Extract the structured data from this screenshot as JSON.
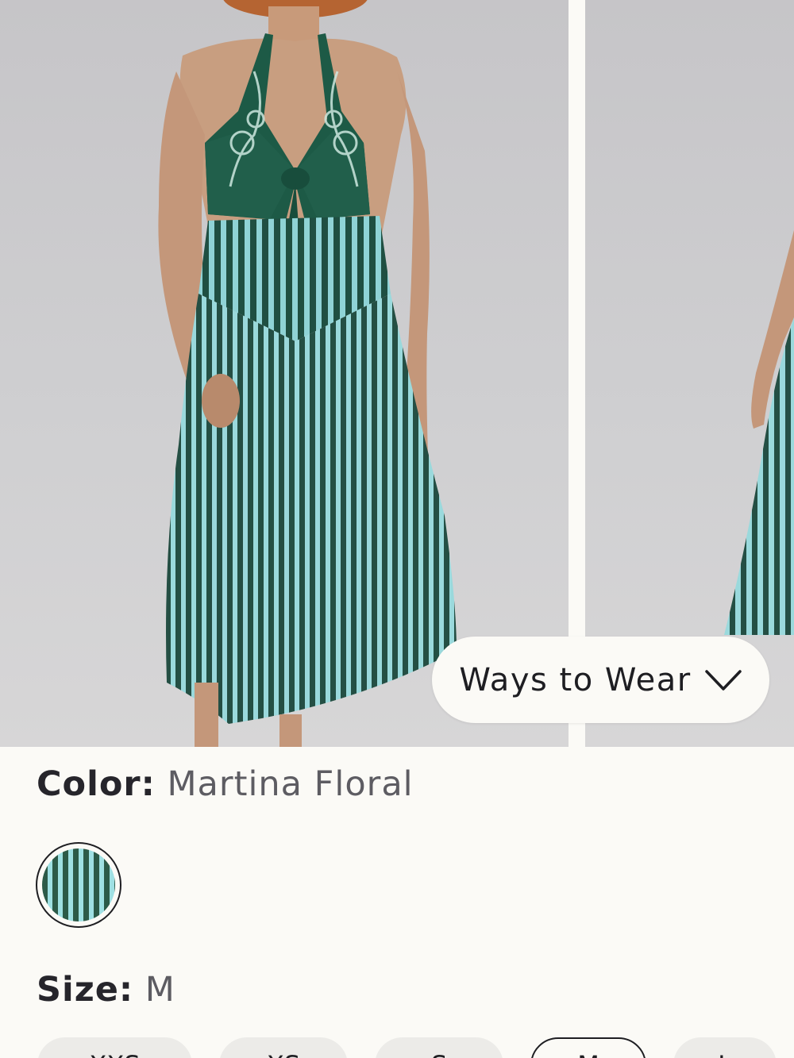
{
  "carousel": {
    "slides": [
      {
        "alt": "model-front-view"
      },
      {
        "alt": "model-side-view"
      }
    ]
  },
  "ways_to_wear": {
    "label": "Ways to Wear",
    "icon": "chevron-down-icon"
  },
  "color": {
    "label": "Color:",
    "value": "Martina Floral",
    "swatches": [
      {
        "name": "Martina Floral",
        "selected": true,
        "stripe_dark": "#2c5a48",
        "stripe_light": "#9fe0e3"
      }
    ]
  },
  "size": {
    "label": "Size:",
    "value": "M",
    "options": [
      "XXS",
      "XS",
      "S",
      "M",
      "L"
    ],
    "selected": "M"
  },
  "colors": {
    "background": "#fbfaf6",
    "text_primary": "#26252b",
    "text_secondary": "#5d5c62",
    "dress_green": "#1f5a48",
    "stripe_light": "#9fe0e3"
  }
}
